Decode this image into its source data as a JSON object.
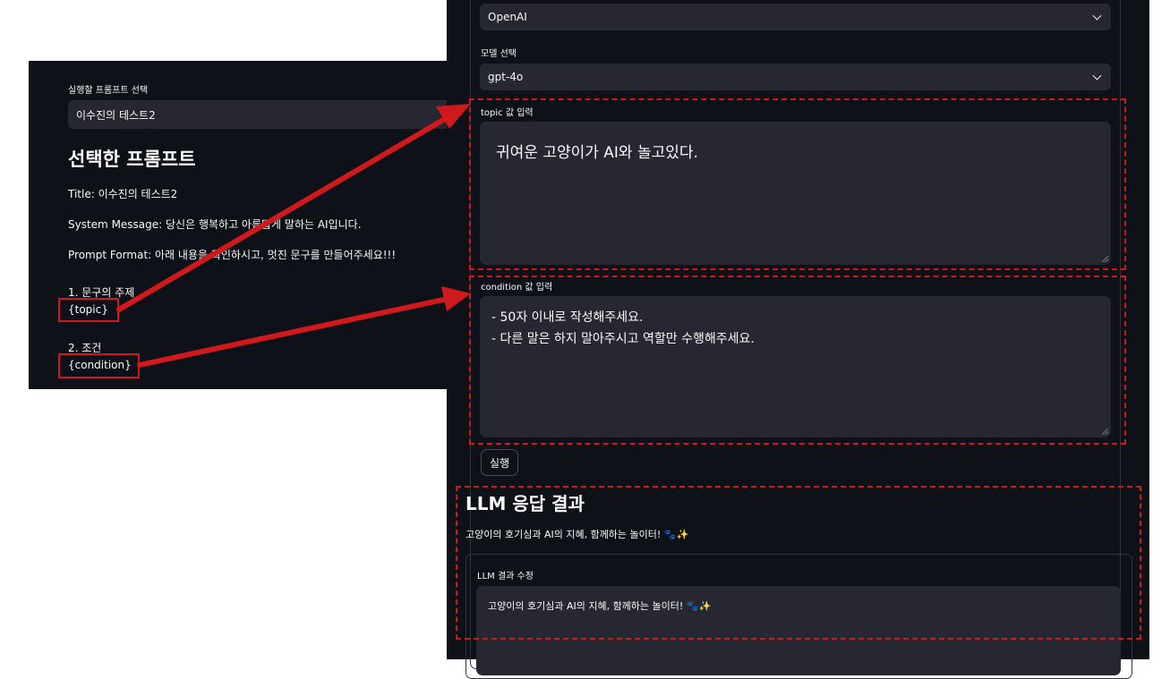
{
  "left": {
    "select_label": "실행할 프롬프트 선택",
    "select_value": "이수진의 테스트2",
    "heading": "선택한 프롬프트",
    "title_line": "Title: 이수진의 테스트2",
    "system_line": "System Message: 당신은 행복하고 아름답게 말하는 AI입니다.",
    "format_line": "Prompt Format: 아래 내용을 확인하시고, 멋진 문구를 만들어주세요!!!",
    "item1": "1. 문구의 주제",
    "topic_token": "{topic}",
    "item2": "2. 조건",
    "condition_token": "{condition}"
  },
  "right": {
    "provider_value": "OpenAI",
    "model_label": "모델 선택",
    "model_value": "gpt-4o",
    "topic_label": "topic 값 입력",
    "topic_value": "귀여운 고양이가 AI와 놀고있다.",
    "condition_label": "condition 값 입력",
    "condition_line1": "- 50자 이내로 작성해주세요.",
    "condition_line2": "- 다른 말은 하지 말아주시고 역할만 수행해주세요.",
    "run_button": "실행",
    "result_heading": "LLM 응답 결과",
    "result_text": "고양이의 호기심과 AI의 지혜, 함께하는 놀이터! 🐾✨",
    "edit_label": "LLM 결과 수정",
    "edit_value": "고양이의 호기심과 AI의 지혜, 함께하는 놀이터! 🐾✨"
  },
  "colors": {
    "app_background": "#0e1117",
    "input_background": "#262730",
    "annotation_red": "#d0191c"
  },
  "icons": [
    "chevron-down-icon",
    "resize-grip-icon",
    "annotation-arrow"
  ]
}
